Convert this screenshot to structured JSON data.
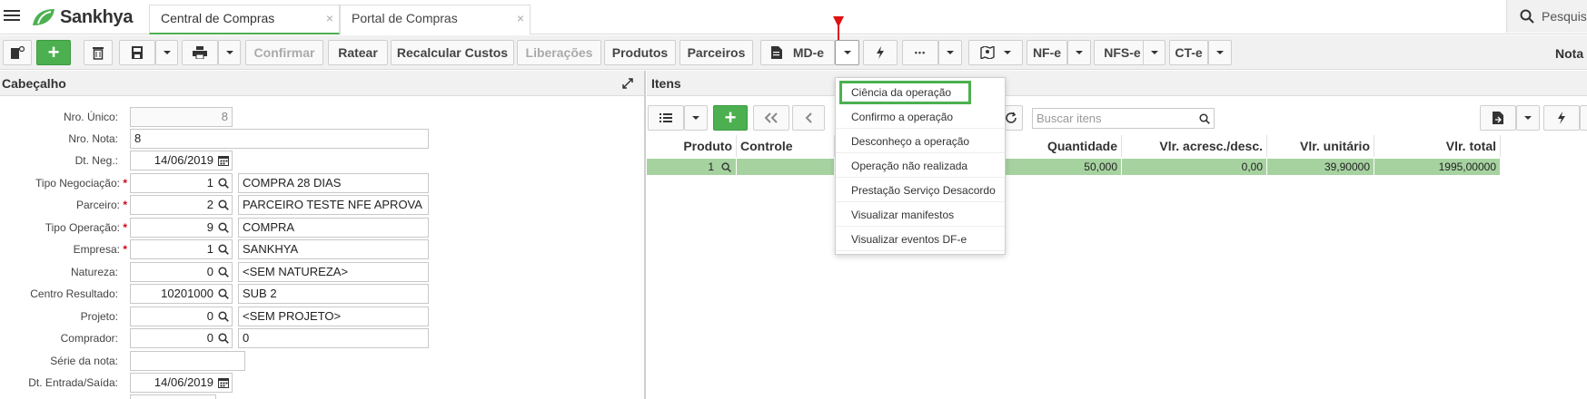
{
  "app": {
    "brand": "Sankhya"
  },
  "tabs": [
    {
      "label": "Central de Compras",
      "close": "×"
    },
    {
      "label": "Portal de Compras",
      "close": "×"
    }
  ],
  "top_search": {
    "placeholder": "Pesquisa"
  },
  "toolbar": {
    "confirmar": "Confirmar",
    "ratear": "Ratear",
    "recalcular": "Recalcular Custos",
    "liberacoes": "Liberações",
    "produtos": "Produtos",
    "parceiros": "Parceiros",
    "mde": "MD-e",
    "dots": "•••",
    "nfe": "NF-e",
    "nfse": "NFS-e",
    "cte": "CT-e",
    "nota": "Nota"
  },
  "cabecalho": {
    "title": "Cabeçalho",
    "fields": {
      "nro_unico": {
        "label": "Nro. Único:",
        "value": "8"
      },
      "nro_nota": {
        "label": "Nro. Nota:",
        "value": "8"
      },
      "dt_neg": {
        "label": "Dt. Neg.:",
        "value": "14/06/2019"
      },
      "tipo_negociacao": {
        "label": "Tipo Negociação:",
        "code": "1",
        "desc": "COMPRA 28 DIAS"
      },
      "parceiro": {
        "label": "Parceiro:",
        "code": "2",
        "desc": "PARCEIRO TESTE NFE APROVA"
      },
      "tipo_operacao": {
        "label": "Tipo Operação:",
        "code": "9",
        "desc": "COMPRA"
      },
      "empresa": {
        "label": "Empresa:",
        "code": "1",
        "desc": "SANKHYA"
      },
      "natureza": {
        "label": "Natureza:",
        "code": "0",
        "desc": "<SEM NATUREZA>"
      },
      "centro_resultado": {
        "label": "Centro Resultado:",
        "code": "10201000",
        "desc": "SUB 2"
      },
      "projeto": {
        "label": "Projeto:",
        "code": "0",
        "desc": "<SEM PROJETO>"
      },
      "comprador": {
        "label": "Comprador:",
        "code": "0",
        "desc": "0"
      },
      "serie_nota": {
        "label": "Série da nota:",
        "value": ""
      },
      "dt_entrada_saida": {
        "label": "Dt. Entrada/Saída:",
        "value": "14/06/2019"
      }
    }
  },
  "itens": {
    "title": "Itens",
    "search_placeholder": "Buscar itens",
    "columns": {
      "produto": "Produto",
      "controle": "Controle",
      "quantidade": "Quantidade",
      "vlr_acresc": "Vlr. acresc./desc.",
      "vlr_unitario": "Vlr. unitário",
      "vlr_total": "Vlr. total"
    },
    "rows": [
      {
        "produto": "1",
        "controle": "",
        "quantidade": "50,000",
        "vlr_acresc": "0,00",
        "vlr_unitario": "39,90000",
        "vlr_total": "1995,00000"
      }
    ]
  },
  "mde_menu": {
    "items": [
      "Ciência da operação",
      "Confirmo a operação",
      "Desconheço a operação",
      "Operação não realizada",
      "Prestação Serviço Desacordo",
      "Visualizar manifestos",
      "Visualizar eventos DF-e"
    ]
  },
  "colors": {
    "accent_green": "#4cb050",
    "row_green": "#a6d2a0",
    "arrow_red": "#e01010"
  },
  "icons": [
    "menu-icon",
    "new-document-icon",
    "add-icon",
    "trash-icon",
    "save-icon",
    "print-icon",
    "lightning-icon",
    "map-icon",
    "search-icon",
    "calendar-icon",
    "list-icon",
    "first-page-icon",
    "prev-page-icon",
    "refresh-icon",
    "export-icon"
  ]
}
